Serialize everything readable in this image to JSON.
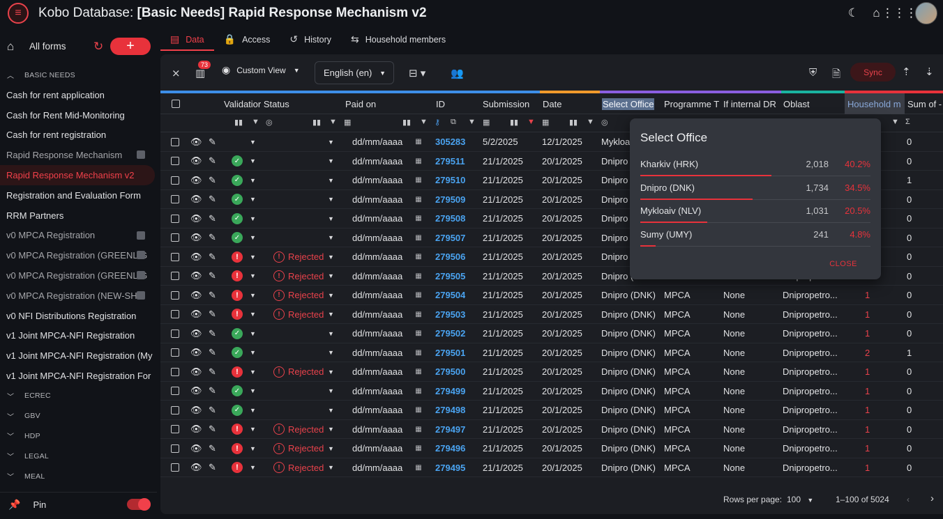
{
  "app": {
    "title_prefix": "Kobo Database: ",
    "title_bold": "[Basic Needs] Rapid Response Mechanism v2"
  },
  "top_icons": [
    "moon-icon",
    "home-icon",
    "apps-grid-icon"
  ],
  "sidebar": {
    "all_forms": "All forms",
    "add_label": "+",
    "basic_needs_group": "BASIC NEEDS",
    "items": [
      {
        "label": "Cash for rent application",
        "state": "normal"
      },
      {
        "label": "Cash for Rent Mid-Monitoring",
        "state": "normal"
      },
      {
        "label": "Cash for rent registration",
        "state": "normal"
      },
      {
        "label": "Rapid Response Mechanism",
        "state": "archived"
      },
      {
        "label": "Rapid Response Mechanism v2",
        "state": "active"
      },
      {
        "label": "Registration and Evaluation Form",
        "state": "normal"
      },
      {
        "label": "RRM Partners",
        "state": "normal"
      },
      {
        "label": "v0 MPCA Registration",
        "state": "archived"
      },
      {
        "label": "v0 MPCA Registration (GREENLIG",
        "state": "archived"
      },
      {
        "label": "v0 MPCA Registration (GREENLIG",
        "state": "archived"
      },
      {
        "label": "v0 MPCA Registration (NEW-SHE",
        "state": "archived"
      },
      {
        "label": "v0 NFI Distributions Registration",
        "state": "normal"
      },
      {
        "label": "v1 Joint MPCA-NFI Registration",
        "state": "normal"
      },
      {
        "label": "v1 Joint MPCA-NFI Registration (My",
        "state": "normal"
      },
      {
        "label": "v1 Joint MPCA-NFI Registration For",
        "state": "normal"
      }
    ],
    "other_groups": [
      "ECREC",
      "GBV",
      "HDP",
      "LEGAL",
      "MEAL"
    ],
    "pin_label": "Pin"
  },
  "tabs": [
    {
      "label": "Data",
      "icon": "table-icon",
      "active": true
    },
    {
      "label": "Access",
      "icon": "lock-icon",
      "active": false
    },
    {
      "label": "History",
      "icon": "history-icon",
      "active": false
    },
    {
      "label": "Household members",
      "icon": "repeat-icon",
      "active": false
    }
  ],
  "toolbar": {
    "badge": "73",
    "custom_view": "Custom View",
    "language": "English (en)",
    "sync": "Sync"
  },
  "columns": {
    "validation": "Validatior Status",
    "paid_on": "Paid on",
    "id": "ID",
    "submission": "Submission",
    "date": "Date",
    "office": "Select Office",
    "programme": "Programme T",
    "if_internal": "If internal DR",
    "oblast": "Oblast",
    "household": "Household m",
    "sum_of": "Sum of -"
  },
  "date_placeholder": "dd/mm/aaaa",
  "rows": [
    {
      "status": "none",
      "paid": "",
      "id": "305283",
      "sub": "5/2/2025",
      "date": "12/1/2025",
      "office": "Mykloa",
      "prog": "",
      "internal": "",
      "oblast": "",
      "hh": "",
      "sum": "0"
    },
    {
      "status": "ok",
      "paid": "",
      "id": "279511",
      "sub": "21/1/2025",
      "date": "20/1/2025",
      "office": "Dnipro",
      "prog": "",
      "internal": "",
      "oblast": "",
      "hh": "",
      "sum": "0"
    },
    {
      "status": "ok",
      "paid": "",
      "id": "279510",
      "sub": "21/1/2025",
      "date": "20/1/2025",
      "office": "Dnipro",
      "prog": "",
      "internal": "",
      "oblast": "",
      "hh": "",
      "sum": "1"
    },
    {
      "status": "ok",
      "paid": "",
      "id": "279509",
      "sub": "21/1/2025",
      "date": "20/1/2025",
      "office": "Dnipro",
      "prog": "",
      "internal": "",
      "oblast": "",
      "hh": "",
      "sum": "0"
    },
    {
      "status": "ok",
      "paid": "",
      "id": "279508",
      "sub": "21/1/2025",
      "date": "20/1/2025",
      "office": "Dnipro",
      "prog": "",
      "internal": "",
      "oblast": "",
      "hh": "",
      "sum": "0"
    },
    {
      "status": "ok",
      "paid": "",
      "id": "279507",
      "sub": "21/1/2025",
      "date": "20/1/2025",
      "office": "Dnipro",
      "prog": "",
      "internal": "",
      "oblast": "",
      "hh": "",
      "sum": "0"
    },
    {
      "status": "err",
      "paid": "Rejected",
      "id": "279506",
      "sub": "21/1/2025",
      "date": "20/1/2025",
      "office": "Dnipro",
      "prog": "",
      "internal": "",
      "oblast": "",
      "hh": "",
      "sum": "0"
    },
    {
      "status": "err",
      "paid": "Rejected",
      "id": "279505",
      "sub": "21/1/2025",
      "date": "20/1/2025",
      "office": "Dnipro (",
      "prog": "MPCA",
      "internal": "None",
      "oblast": "Dnipropetro...",
      "hh": "",
      "sum": "0"
    },
    {
      "status": "err",
      "paid": "Rejected",
      "id": "279504",
      "sub": "21/1/2025",
      "date": "20/1/2025",
      "office": "Dnipro (DNK)",
      "prog": "MPCA",
      "internal": "None",
      "oblast": "Dnipropetro...",
      "hh": "1",
      "sum": "0"
    },
    {
      "status": "err",
      "paid": "Rejected",
      "id": "279503",
      "sub": "21/1/2025",
      "date": "20/1/2025",
      "office": "Dnipro (DNK)",
      "prog": "MPCA",
      "internal": "None",
      "oblast": "Dnipropetro...",
      "hh": "1",
      "sum": "0"
    },
    {
      "status": "ok",
      "paid": "",
      "id": "279502",
      "sub": "21/1/2025",
      "date": "20/1/2025",
      "office": "Dnipro (DNK)",
      "prog": "MPCA",
      "internal": "None",
      "oblast": "Dnipropetro...",
      "hh": "1",
      "sum": "0"
    },
    {
      "status": "ok",
      "paid": "",
      "id": "279501",
      "sub": "21/1/2025",
      "date": "20/1/2025",
      "office": "Dnipro (DNK)",
      "prog": "MPCA",
      "internal": "None",
      "oblast": "Dnipropetro...",
      "hh": "2",
      "sum": "1"
    },
    {
      "status": "err",
      "paid": "Rejected",
      "id": "279500",
      "sub": "21/1/2025",
      "date": "20/1/2025",
      "office": "Dnipro (DNK)",
      "prog": "MPCA",
      "internal": "None",
      "oblast": "Dnipropetro...",
      "hh": "1",
      "sum": "0"
    },
    {
      "status": "ok",
      "paid": "",
      "id": "279499",
      "sub": "21/1/2025",
      "date": "20/1/2025",
      "office": "Dnipro (DNK)",
      "prog": "MPCA",
      "internal": "None",
      "oblast": "Dnipropetro...",
      "hh": "1",
      "sum": "0"
    },
    {
      "status": "ok",
      "paid": "",
      "id": "279498",
      "sub": "21/1/2025",
      "date": "20/1/2025",
      "office": "Dnipro (DNK)",
      "prog": "MPCA",
      "internal": "None",
      "oblast": "Dnipropetro...",
      "hh": "1",
      "sum": "0"
    },
    {
      "status": "err",
      "paid": "Rejected",
      "id": "279497",
      "sub": "21/1/2025",
      "date": "20/1/2025",
      "office": "Dnipro (DNK)",
      "prog": "MPCA",
      "internal": "None",
      "oblast": "Dnipropetro...",
      "hh": "1",
      "sum": "0"
    },
    {
      "status": "err",
      "paid": "Rejected",
      "id": "279496",
      "sub": "21/1/2025",
      "date": "20/1/2025",
      "office": "Dnipro (DNK)",
      "prog": "MPCA",
      "internal": "None",
      "oblast": "Dnipropetro...",
      "hh": "1",
      "sum": "0"
    },
    {
      "status": "err",
      "paid": "Rejected",
      "id": "279495",
      "sub": "21/1/2025",
      "date": "20/1/2025",
      "office": "Dnipro (DNK)",
      "prog": "MPCA",
      "internal": "None",
      "oblast": "Dnipropetro...",
      "hh": "1",
      "sum": "0"
    }
  ],
  "footer": {
    "rows_per_page_label": "Rows per page:",
    "rows_per_page": "100",
    "range": "1–100 of 5024"
  },
  "popup": {
    "title": "Select Office",
    "entries": [
      {
        "label": "Kharkiv (HRK)",
        "count": "2,018",
        "pct": "40.2%",
        "fraction": 0.402
      },
      {
        "label": "Dnipro (DNK)",
        "count": "1,734",
        "pct": "34.5%",
        "fraction": 0.345
      },
      {
        "label": "Mykloaiv (NLV)",
        "count": "1,031",
        "pct": "20.5%",
        "fraction": 0.205
      },
      {
        "label": "Sumy (UMY)",
        "count": "241",
        "pct": "4.8%",
        "fraction": 0.048
      }
    ],
    "close": "CLOSE"
  },
  "colors": {
    "accent": "#e8323b",
    "link": "#4aa3f0",
    "ok": "#3aa85a"
  }
}
